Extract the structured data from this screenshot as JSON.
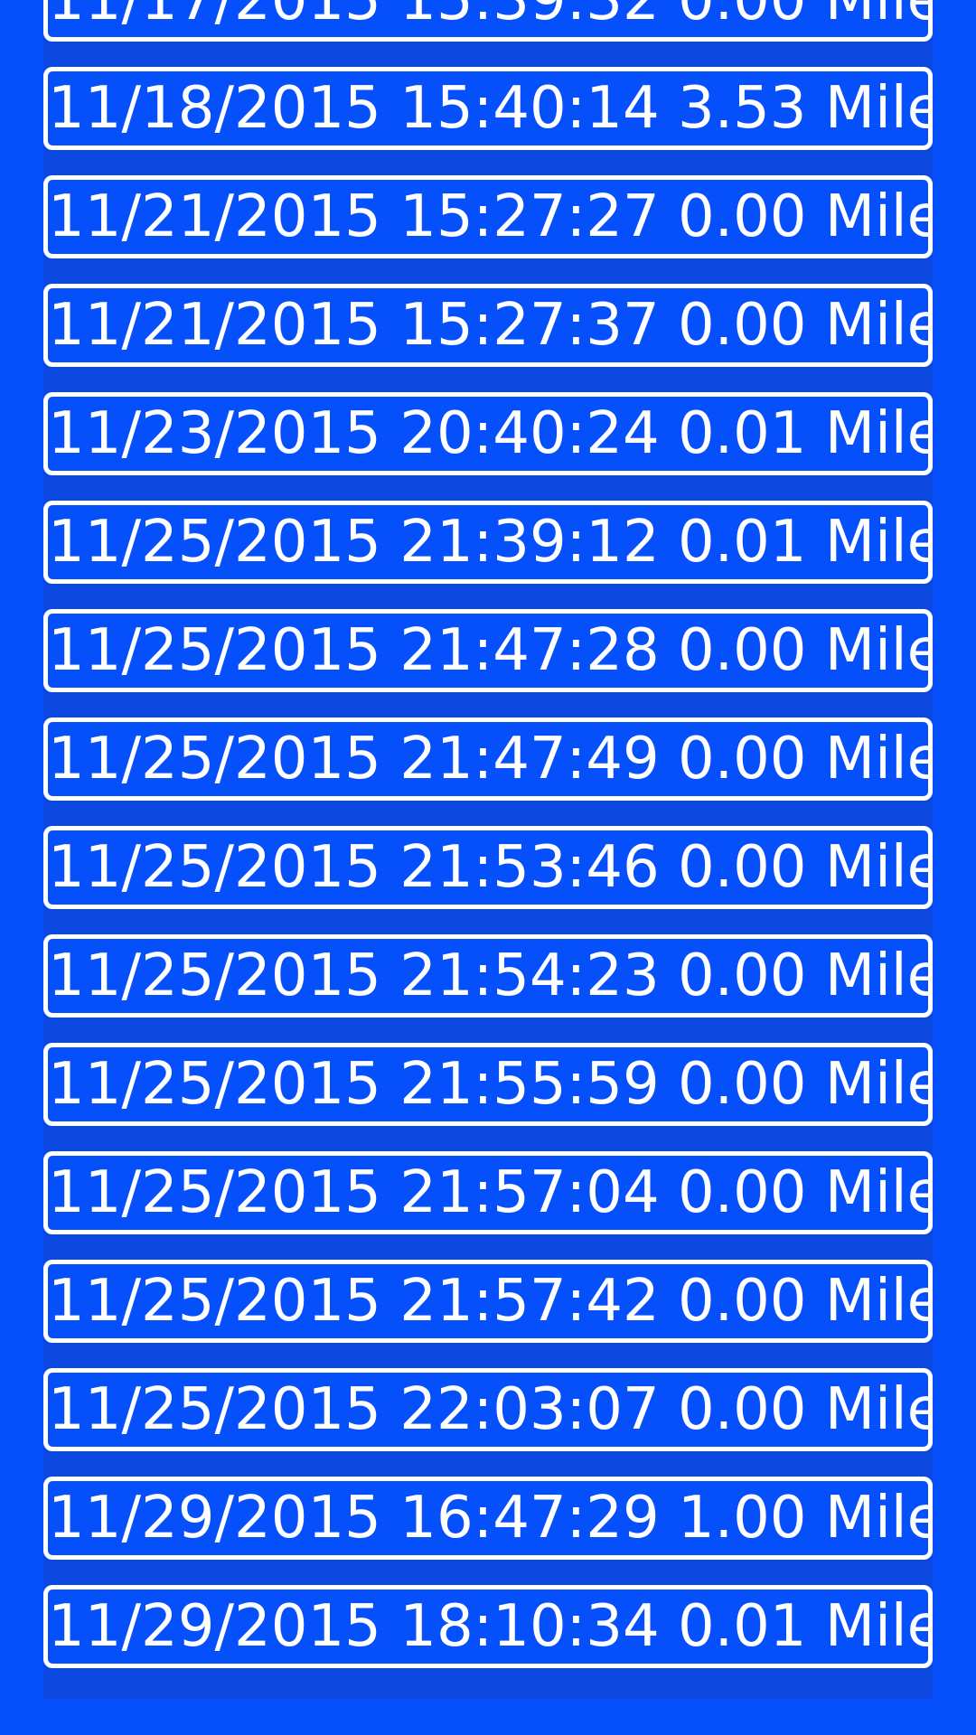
{
  "entries": [
    {
      "date": "11/17/2015",
      "time": "15:39:32",
      "distance": "0.00",
      "unit": "Miles"
    },
    {
      "date": "11/18/2015",
      "time": "15:40:14",
      "distance": "3.53",
      "unit": "Miles"
    },
    {
      "date": "11/21/2015",
      "time": "15:27:27",
      "distance": "0.00",
      "unit": "Miles"
    },
    {
      "date": "11/21/2015",
      "time": "15:27:37",
      "distance": "0.00",
      "unit": "Miles"
    },
    {
      "date": "11/23/2015",
      "time": "20:40:24",
      "distance": "0.01",
      "unit": "Miles"
    },
    {
      "date": "11/25/2015",
      "time": "21:39:12",
      "distance": "0.01",
      "unit": "Miles"
    },
    {
      "date": "11/25/2015",
      "time": "21:47:28",
      "distance": "0.00",
      "unit": "Miles"
    },
    {
      "date": "11/25/2015",
      "time": "21:47:49",
      "distance": "0.00",
      "unit": "Miles"
    },
    {
      "date": "11/25/2015",
      "time": "21:53:46",
      "distance": "0.00",
      "unit": "Miles"
    },
    {
      "date": "11/25/2015",
      "time": "21:54:23",
      "distance": "0.00",
      "unit": "Miles"
    },
    {
      "date": "11/25/2015",
      "time": "21:55:59",
      "distance": "0.00",
      "unit": "Miles"
    },
    {
      "date": "11/25/2015",
      "time": "21:57:04",
      "distance": "0.00",
      "unit": "Miles"
    },
    {
      "date": "11/25/2015",
      "time": "21:57:42",
      "distance": "0.00",
      "unit": "Miles"
    },
    {
      "date": "11/25/2015",
      "time": "22:03:07",
      "distance": "0.00",
      "unit": "Miles"
    },
    {
      "date": "11/29/2015",
      "time": "16:47:29",
      "distance": "1.00",
      "unit": "Miles"
    },
    {
      "date": "11/29/2015",
      "time": "18:10:34",
      "distance": "0.01",
      "unit": "Miles"
    }
  ],
  "colors": {
    "background": "#0650FB",
    "panel": "#0C48E0",
    "border": "#FFFFFF",
    "text": "#FFFFFF"
  }
}
